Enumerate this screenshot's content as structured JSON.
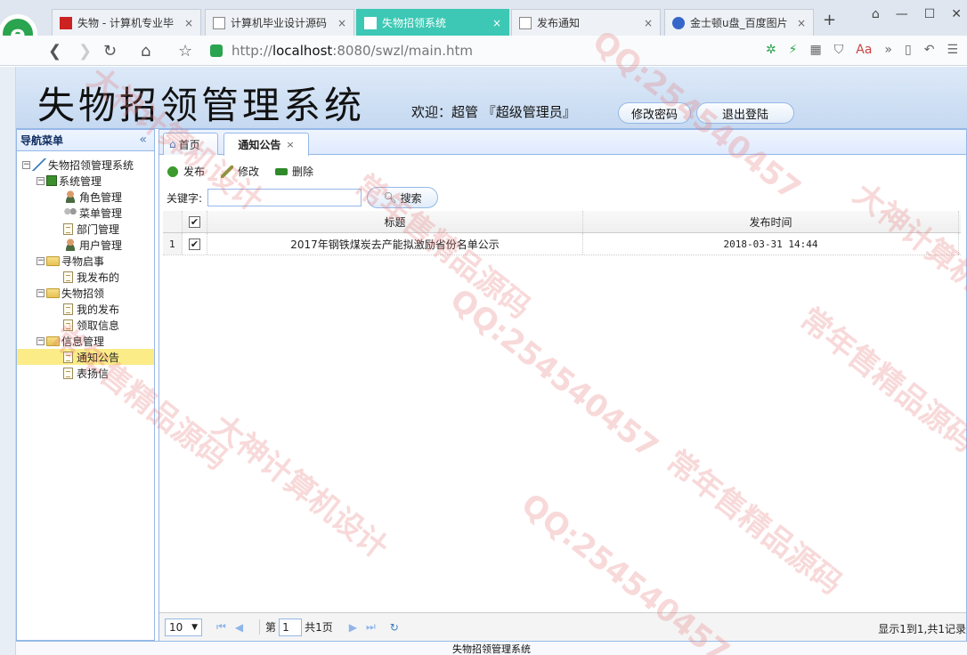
{
  "browser": {
    "tabs": [
      {
        "title": "失物 - 计算机专业毕",
        "active": false
      },
      {
        "title": "计算机毕业设计源码",
        "active": false
      },
      {
        "title": "失物招领系统",
        "active": true
      },
      {
        "title": "发布通知",
        "active": false
      },
      {
        "title": "金士顿u盘_百度图片",
        "active": false
      }
    ],
    "tab_close": "×",
    "new_tab": "+",
    "url_scheme": "http://",
    "url_host": "localhost",
    "url_path": ":8080/swzl/main.htm"
  },
  "header": {
    "system_title": "失物招领管理系统",
    "welcome": "欢迎：超管 『超级管理员』",
    "change_password": "修改密码",
    "logout": "退出登陆"
  },
  "nav": {
    "title": "导航菜单",
    "root": "失物招领管理系统",
    "groups": [
      {
        "label": "系统管理",
        "items": [
          "角色管理",
          "菜单管理",
          "部门管理",
          "用户管理"
        ]
      },
      {
        "label": "寻物启事",
        "items": [
          "我发布的"
        ]
      },
      {
        "label": "失物招领",
        "items": [
          "我的发布",
          "领取信息"
        ]
      },
      {
        "label": "信息管理",
        "items": [
          "通知公告",
          "表扬信"
        ]
      }
    ],
    "selected": "通知公告"
  },
  "content": {
    "tabs": [
      {
        "label": "首页"
      },
      {
        "label": "通知公告"
      }
    ],
    "toolbar": {
      "add": "发布",
      "edit": "修改",
      "delete": "删除"
    },
    "search": {
      "label": "关键字:",
      "value": "",
      "button": "搜索"
    },
    "grid": {
      "columns": [
        "标题",
        "发布时间"
      ],
      "rows": [
        {
          "num": "1",
          "title": "2017年钢铁煤炭去产能拟激励省份名单公示",
          "time": "2018-03-31 14:44"
        }
      ]
    },
    "pager": {
      "page_size": "10",
      "page_prefix": "第",
      "page_value": "1",
      "page_suffix": "共1页",
      "info": "显示1到1,共1记录"
    }
  },
  "footer": {
    "text": "失物招领管理系统"
  },
  "watermarks": {
    "a": "大神计算机设计",
    "b": "QQ:254540457",
    "c": "常年售精品源码"
  },
  "colors": {
    "active_tab": "#3cc8b4",
    "panel_border": "#95b8e7",
    "selected_node": "#fbec88"
  }
}
